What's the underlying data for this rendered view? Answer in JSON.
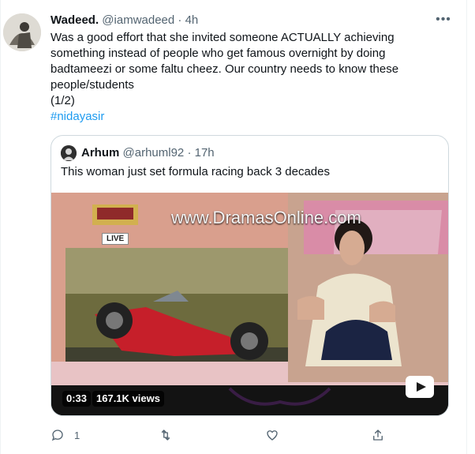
{
  "tweet": {
    "author_name": "Wadeed.",
    "author_handle": "@iamwadeed",
    "separator": "·",
    "time": "4h",
    "text": "Was a good effort that she invited someone ACTUALLY achieving\nsomething instead of people who get famous overnight by doing\nbadtameezi or some faltu cheez. Our country needs to know these\npeople/students\n(1/2)",
    "hashtag": "#nidayasir",
    "more_icon": "more-horizontal-icon"
  },
  "quoted_tweet": {
    "author_name": "Arhum",
    "author_handle": "@arhuml92",
    "separator": "·",
    "time": "17h",
    "text": "This woman just set formula racing back 3 decades",
    "video": {
      "watermark": "www.DramasOnline.com",
      "channel_live": "LIVE",
      "duration": "0:33",
      "views": "167.1K views"
    }
  },
  "actions": {
    "reply_count": "1",
    "retweet_count": "",
    "like_count": "",
    "icons": [
      "reply-icon",
      "retweet-icon",
      "like-icon",
      "share-icon"
    ]
  },
  "colors": {
    "text": "#0f1419",
    "secondary": "#536471",
    "link": "#1d9bf0",
    "border": "#cfd9de"
  }
}
